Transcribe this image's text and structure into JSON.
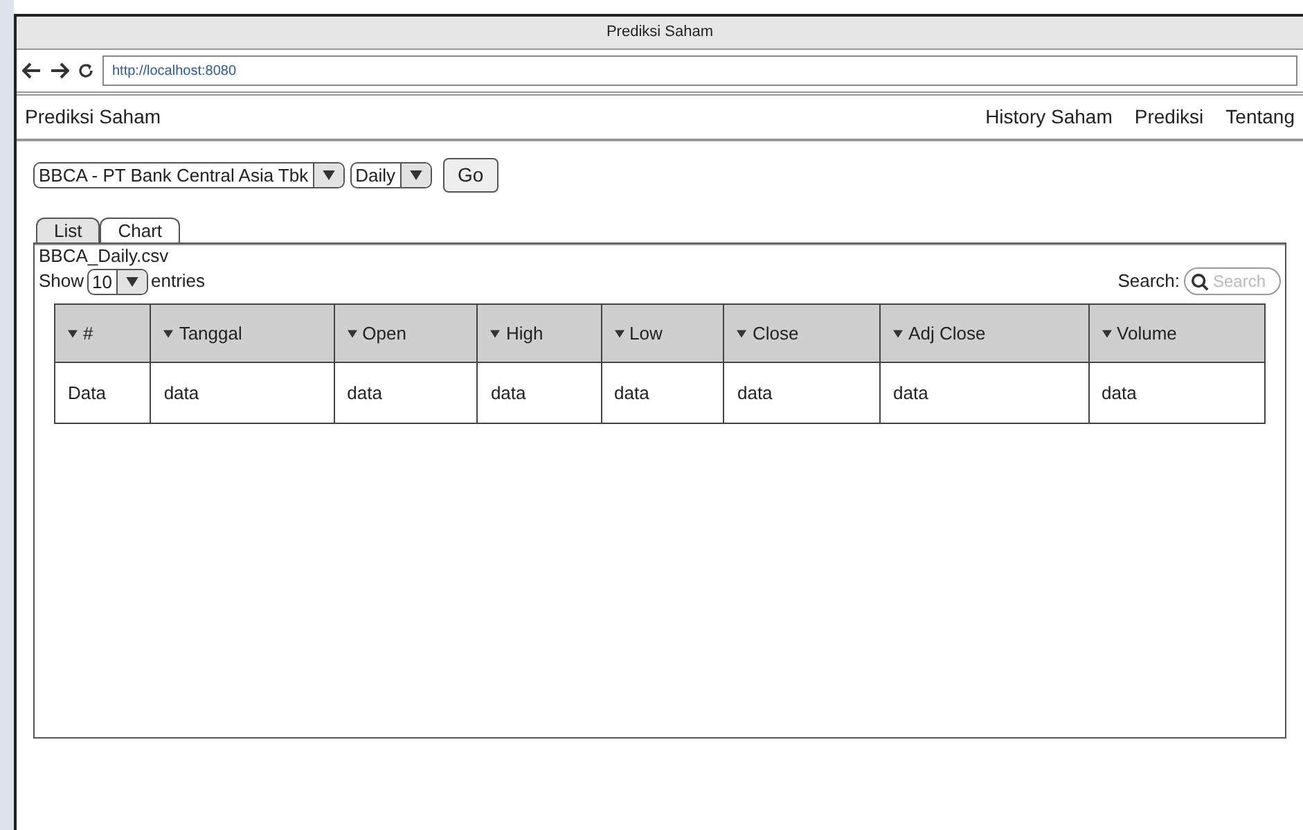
{
  "window": {
    "title": "Prediksi Saham"
  },
  "browser": {
    "url": "http://localhost:8080"
  },
  "navbar": {
    "brand": "Prediksi Saham",
    "links": [
      "History Saham",
      "Prediksi",
      "Tentang"
    ]
  },
  "controls": {
    "stock_select": "BBCA - PT Bank Central Asia Tbk",
    "period_select": "Daily",
    "go_button": "Go"
  },
  "tabs": [
    {
      "label": "List",
      "selected": true
    },
    {
      "label": "Chart",
      "selected": false
    }
  ],
  "file_name": "BBCA_Daily.csv",
  "length_control": {
    "prefix": "Show",
    "value": "10",
    "suffix": "entries"
  },
  "search": {
    "label": "Search:",
    "placeholder": "Search"
  },
  "table": {
    "columns": [
      "#",
      "Tanggal",
      "Open",
      "High",
      "Low",
      "Close",
      "Adj Close",
      "Volume"
    ],
    "rows": [
      [
        "Data",
        "data",
        "data",
        "data",
        "data",
        "data",
        "data",
        "data"
      ]
    ]
  }
}
